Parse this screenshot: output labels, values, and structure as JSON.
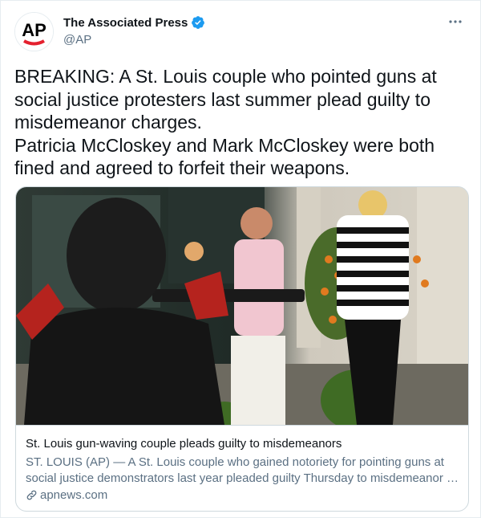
{
  "author": {
    "logo_text": "AP",
    "display_name": "The Associated Press",
    "handle": "@AP",
    "verified": true,
    "icons": {
      "verified": "verified-badge-icon",
      "more": "more-options-icon"
    }
  },
  "tweet": {
    "lines": [
      "BREAKING: A St. Louis couple who pointed guns at social justice protesters last summer plead guilty to misdemeanor charges.",
      "Patricia McCloskey and Mark McCloskey were both fined and agreed to forfeit their weapons."
    ]
  },
  "card": {
    "title": "St. Louis gun-waving couple pleads guilty to misdemeanors",
    "description_line1": "ST. LOUIS (AP) — A St. Louis couple who gained notoriety for pointing guns at",
    "description_line2": "social justice demonstrators last year pleaded guilty Thursday to misdemeanor …",
    "domain": "apnews.com",
    "link_icon": "link-icon"
  },
  "colors": {
    "text": "#0f1419",
    "secondary": "#5b7083",
    "verified": "#1d9bf0",
    "ap_red": "#e4202e",
    "border": "#cfd9de"
  }
}
